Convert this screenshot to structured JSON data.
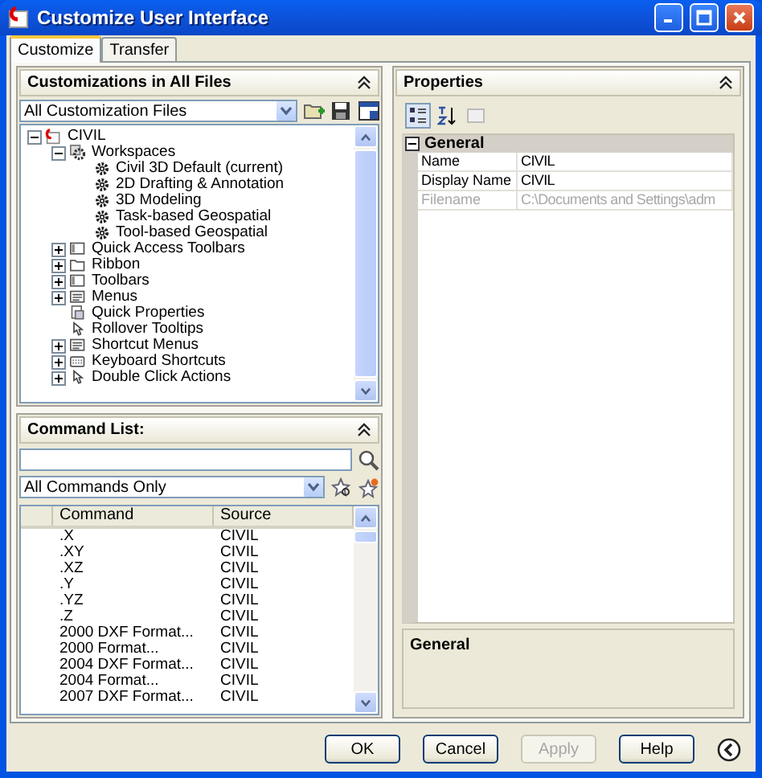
{
  "window": {
    "title": "Customize User Interface"
  },
  "tabs": [
    {
      "label": "Customize",
      "selected": true
    },
    {
      "label": "Transfer",
      "selected": false
    }
  ],
  "customizations": {
    "title": "Customizations in All Files",
    "file_filter": "All Customization Files",
    "tree": [
      {
        "label": "CIVIL",
        "kind": "file",
        "expanded": true,
        "children": [
          {
            "label": "Workspaces",
            "kind": "workspaces",
            "expanded": true,
            "children": [
              {
                "label": "Civil 3D Default (current)",
                "kind": "workspace"
              },
              {
                "label": "2D Drafting & Annotation",
                "kind": "workspace"
              },
              {
                "label": "3D Modeling",
                "kind": "workspace"
              },
              {
                "label": "Task-based Geospatial",
                "kind": "workspace"
              },
              {
                "label": "Tool-based Geospatial",
                "kind": "workspace"
              }
            ]
          },
          {
            "label": "Quick Access Toolbars",
            "kind": "toolbar",
            "expanded": false
          },
          {
            "label": "Ribbon",
            "kind": "folder",
            "expanded": false
          },
          {
            "label": "Toolbars",
            "kind": "toolbar",
            "expanded": false
          },
          {
            "label": "Menus",
            "kind": "menu",
            "expanded": false
          },
          {
            "label": "Quick Properties",
            "kind": "properties"
          },
          {
            "label": "Rollover Tooltips",
            "kind": "pointer"
          },
          {
            "label": "Shortcut Menus",
            "kind": "menu",
            "expanded": false
          },
          {
            "label": "Keyboard Shortcuts",
            "kind": "keyboard",
            "expanded": false
          },
          {
            "label": "Double Click Actions",
            "kind": "pointer",
            "expanded": false
          }
        ]
      }
    ]
  },
  "command_list": {
    "title": "Command List:",
    "filter": "All Commands Only",
    "columns": [
      "Command",
      "Source"
    ],
    "rows": [
      [
        ".X",
        "CIVIL"
      ],
      [
        ".XY",
        "CIVIL"
      ],
      [
        ".XZ",
        "CIVIL"
      ],
      [
        ".Y",
        "CIVIL"
      ],
      [
        ".YZ",
        "CIVIL"
      ],
      [
        ".Z",
        "CIVIL"
      ],
      [
        "2000 DXF Format...",
        "CIVIL"
      ],
      [
        "2000 Format...",
        "CIVIL"
      ],
      [
        "2004 DXF Format...",
        "CIVIL"
      ],
      [
        "2004 Format...",
        "CIVIL"
      ],
      [
        "2007 DXF Format...",
        "CIVIL"
      ]
    ]
  },
  "properties": {
    "title": "Properties",
    "categories": [
      {
        "label": "General",
        "expanded": true,
        "rows": [
          {
            "name": "Name",
            "value": "CIVIL",
            "disabled": false
          },
          {
            "name": "Display Name",
            "value": "CIVIL",
            "disabled": false
          },
          {
            "name": "Filename",
            "value": "C:\\Documents and Settings\\adm",
            "disabled": true
          }
        ]
      }
    ],
    "description_title": "General"
  },
  "buttons": [
    {
      "label": "OK",
      "disabled": false
    },
    {
      "label": "Cancel",
      "disabled": false
    },
    {
      "label": "Apply",
      "disabled": true
    },
    {
      "label": "Help",
      "disabled": false
    }
  ]
}
